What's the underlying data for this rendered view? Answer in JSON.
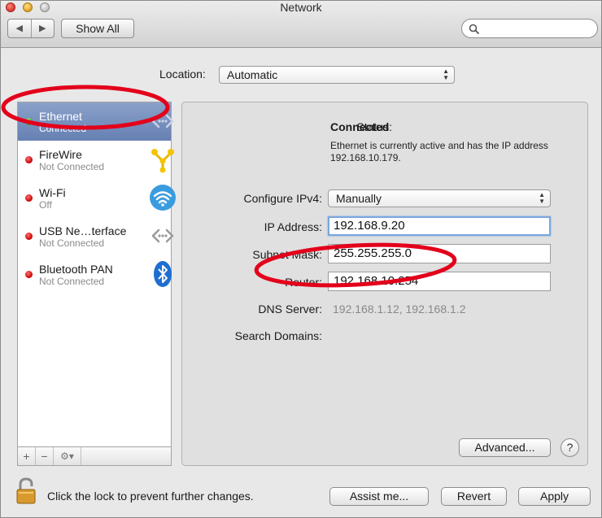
{
  "window": {
    "title": "Network"
  },
  "toolbar": {
    "back_icon": "back-arrow-icon",
    "forward_icon": "forward-arrow-icon",
    "show_all_label": "Show All",
    "search_value": ""
  },
  "location": {
    "label": "Location:",
    "value": "Automatic"
  },
  "services": [
    {
      "name": "Ethernet",
      "status": "Connected",
      "indicator": "green",
      "icon": "ethernet-icon",
      "selected": true
    },
    {
      "name": "FireWire",
      "status": "Not Connected",
      "indicator": "red",
      "icon": "firewire-icon",
      "selected": false
    },
    {
      "name": "Wi-Fi",
      "status": "Off",
      "indicator": "red",
      "icon": "wifi-icon",
      "selected": false
    },
    {
      "name": "USB Ne…terface",
      "status": "Not Connected",
      "indicator": "red",
      "icon": "usb-ethernet-icon",
      "selected": false
    },
    {
      "name": "Bluetooth PAN",
      "status": "Not Connected",
      "indicator": "red",
      "icon": "bluetooth-icon",
      "selected": false
    }
  ],
  "sidebar_controls": {
    "add": "+",
    "remove": "−",
    "gear": "⚙▾"
  },
  "detail": {
    "status_label": "Status:",
    "status_value": "Connected",
    "status_description": "Ethernet is currently active and has the IP address 192.168.10.179.",
    "configure_label": "Configure IPv4:",
    "configure_value": "Manually",
    "ip_label": "IP Address:",
    "ip_value": "192.168.9.20",
    "subnet_label": "Subnet Mask:",
    "subnet_value": "255.255.255.0",
    "router_label": "Router:",
    "router_value": "192.168.10.254",
    "dns_label": "DNS Server:",
    "dns_value": "192.168.1.12, 192.168.1.2",
    "search_domains_label": "Search Domains:",
    "advanced_label": "Advanced...",
    "help_label": "?"
  },
  "footer": {
    "lock_text": "Click the lock to prevent further changes.",
    "assist_label": "Assist me...",
    "revert_label": "Revert",
    "apply_label": "Apply"
  },
  "colors": {
    "selection": "#6f89bb",
    "annotation": "#e3001b",
    "focus_ring": "#7aa6dc"
  }
}
